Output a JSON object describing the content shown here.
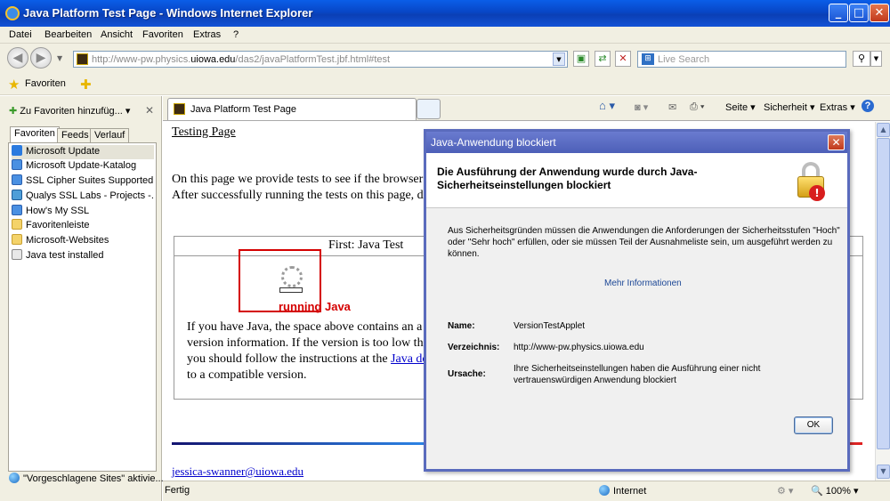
{
  "window": {
    "title": "Java Platform Test Page - Windows Internet Explorer",
    "buttons": {
      "minimize": "_",
      "maximize": "□",
      "close": "✕"
    }
  },
  "menu": [
    "Datei",
    "Bearbeiten",
    "Ansicht",
    "Favoriten",
    "Extras",
    "?"
  ],
  "address": {
    "url_prefix": "http://www-pw.physics.",
    "url_host": "uiowa.edu",
    "url_suffix": "/das2/javaPlatformTest.jbf.html#test"
  },
  "search": {
    "placeholder": "Live Search"
  },
  "favbar": {
    "favorites_label": "Favoriten"
  },
  "leftpane": {
    "add_favorites": "Zu Favoriten hinzufüg...",
    "tabs": [
      "Favoriten",
      "Feeds",
      "Verlauf"
    ],
    "items": [
      {
        "label": "Microsoft Update",
        "icon": "windows-update-icon"
      },
      {
        "label": "Microsoft Update-Katalog",
        "icon": "ie-page-icon"
      },
      {
        "label": "SSL Cipher Suites Supported...",
        "icon": "ie-page-icon"
      },
      {
        "label": "Qualys SSL Labs - Projects -...",
        "icon": "lock-page-icon"
      },
      {
        "label": "How's My SSL",
        "icon": "ie-page-icon"
      },
      {
        "label": "Favoritenleiste",
        "icon": "folder-icon"
      },
      {
        "label": "Microsoft-Websites",
        "icon": "folder-icon"
      },
      {
        "label": "Java test installed",
        "icon": "java-page-icon"
      }
    ],
    "suggested": "\"Vorgeschlagene Sites\" aktivie..."
  },
  "tab": {
    "title": "Java Platform Test Page"
  },
  "commandbar": {
    "seite": "Seite",
    "sicherheit": "Sicherheit",
    "extras": "Extras"
  },
  "page": {
    "testing_link": "Testing Page",
    "intro_line1": "On this page we provide tests to see if the browser",
    "intro_line2": "After successfully running the tests on this page, das",
    "table_header": "First: Java Test",
    "running": "running Java",
    "para": [
      "If you have Java, the space above contains an a",
      "version information. If the version is too low the",
      "you should follow the instructions at the",
      "to a compatible version."
    ],
    "para_link": "Java do",
    "email": "jessica-swanner@uiowa.edu"
  },
  "status": {
    "left": "Fertig",
    "zone": "Internet",
    "zoom": "100%"
  },
  "dialog": {
    "title": "Java-Anwendung blockiert",
    "heading": "Die Ausführung der Anwendung wurde durch Java-Sicherheitseinstellungen blockiert",
    "message": "Aus Sicherheitsgründen müssen die Anwendungen die Anforderungen der Sicherheitsstufen \"Hoch\" oder \"Sehr hoch\" erfüllen, oder sie müssen Teil der Ausnahmeliste sein, um ausgeführt werden zu können.",
    "more_info": "Mehr Informationen",
    "name_label": "Name:",
    "name_value": "VersionTestApplet",
    "dir_label": "Verzeichnis:",
    "dir_value": "http://www-pw.physics.uiowa.edu",
    "reason_label": "Ursache:",
    "reason_value": "Ihre Sicherheitseinstellungen haben die Ausführung einer nicht vertrauenswürdigen Anwendung blockiert",
    "ok": "OK"
  }
}
